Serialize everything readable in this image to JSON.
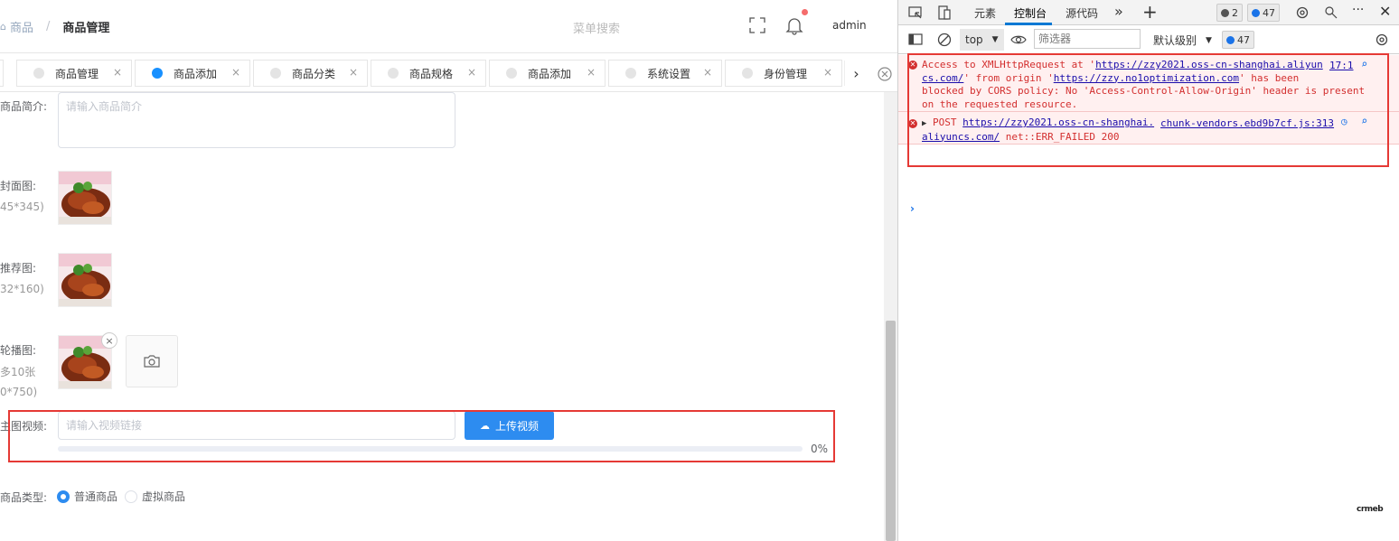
{
  "app": {
    "breadcrumb": {
      "home_icon": "home-icon",
      "root": "商品",
      "separator": "/",
      "current": "商品管理"
    },
    "menu_search": "菜单搜索",
    "user": "admin",
    "tabs": [
      {
        "label": "商品管理",
        "active": false
      },
      {
        "label": "商品添加",
        "active": true
      },
      {
        "label": "商品分类",
        "active": false
      },
      {
        "label": "商品规格",
        "active": false
      },
      {
        "label": "商品添加",
        "active": false
      },
      {
        "label": "系统设置",
        "active": false
      },
      {
        "label": "身份管理",
        "active": false
      }
    ],
    "tab_close": "×",
    "form": {
      "intro_label": "商品简介:",
      "intro_placeholder": "请输入商品简介",
      "cover_label": "封面图:",
      "cover_size": "45*345)",
      "recommend_label": "推荐图:",
      "recommend_size": "32*160)",
      "carousel_label": "轮播图:",
      "carousel_max": "多10张",
      "carousel_size": "0*750)",
      "video_label": "主图视频:",
      "video_placeholder": "请输入视频链接",
      "upload_button": "上传视频",
      "progress_percent": 0,
      "progress_text": "0%",
      "type_label": "商品类型:",
      "type_options": [
        {
          "label": "普通商品",
          "checked": true
        },
        {
          "label": "虚拟商品",
          "checked": false
        }
      ]
    },
    "colors": {
      "primary": "#2d8cf0",
      "highlight": "#e53935",
      "active_tab_dot": "#1890ff"
    }
  },
  "devtools": {
    "tabs": [
      {
        "label": "元素",
        "active": false
      },
      {
        "label": "控制台",
        "active": true
      },
      {
        "label": "源代码",
        "active": false
      }
    ],
    "more": "»",
    "add": "+",
    "error_count": "2",
    "message_count": "47",
    "context": "top",
    "filter_placeholder": "筛选器",
    "level": "默认级别",
    "toolbar_message_count": "47",
    "messages": [
      {
        "pre": "Access to XMLHttpRequest at '",
        "url1": "https://zzy2021.oss-cn-shanghai.aliyun",
        "url1b": "cs.com/",
        "mid": "' from origin '",
        "url2": "https://zzy.no1optimization.com",
        "post1": "' has been",
        "line3": "blocked by CORS policy: No 'Access-Control-Allow-Origin' header is present",
        "line4": "on the requested resource.",
        "source": "17:1"
      },
      {
        "method": "POST",
        "url": "https://zzy2021.oss-cn-shanghai.",
        "url_b": "aliyuncs.com/",
        "error": "net::ERR_FAILED 200",
        "source": "chunk-vendors.ebd9b7cf.js:313"
      }
    ],
    "prompt": "›",
    "watermark": "crmeb"
  }
}
